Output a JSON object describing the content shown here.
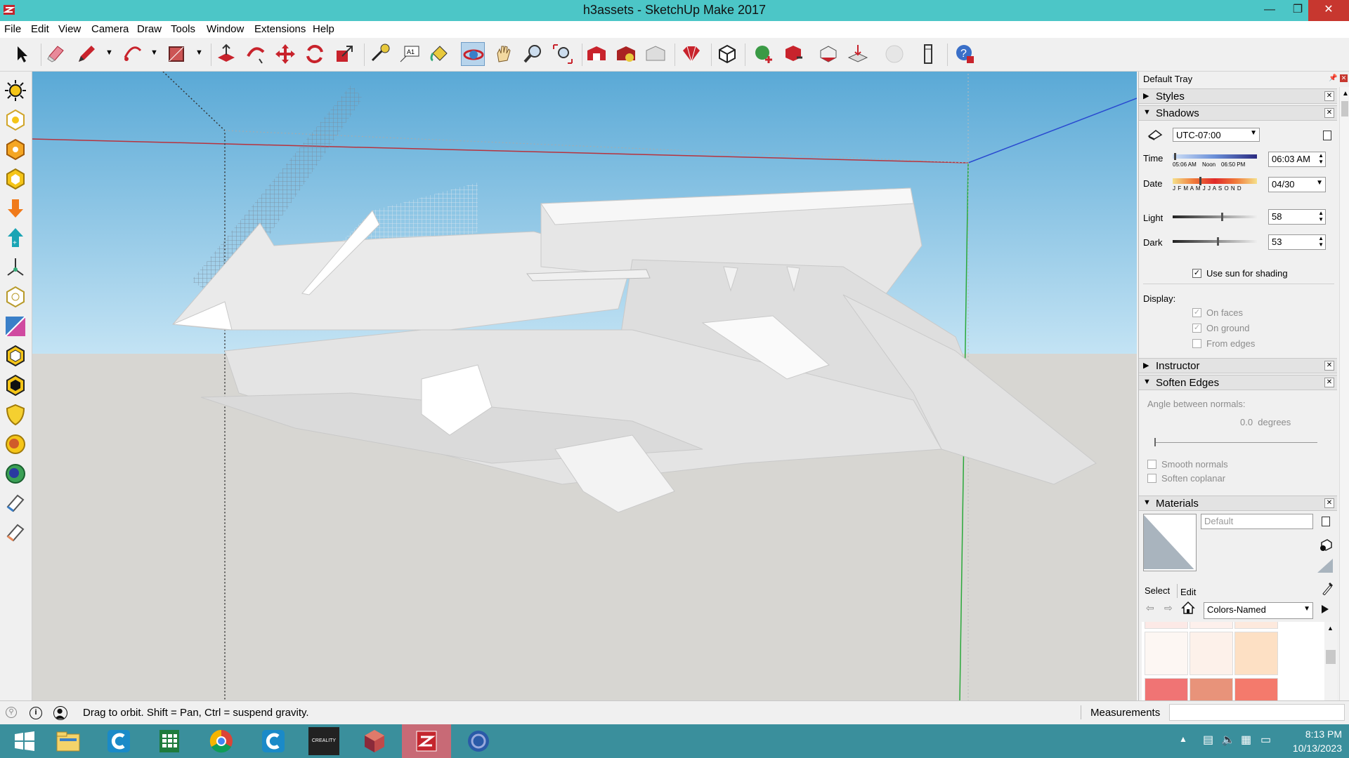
{
  "window": {
    "title": "h3assets - SketchUp Make 2017",
    "controls": [
      "minimize-icon",
      "restore-icon",
      "close-icon"
    ]
  },
  "menu": [
    "File",
    "Edit",
    "View",
    "Camera",
    "Draw",
    "Tools",
    "Window",
    "Extensions",
    "Help"
  ],
  "toolbar": {
    "tools": [
      "select-icon",
      "eraser-icon",
      "pencil-icon",
      "arc-icon",
      "rectangle-icon",
      "push-pull-icon",
      "follow-me-icon",
      "move-icon",
      "rotate-icon",
      "scale-icon",
      "tape-measure-icon",
      "text-icon",
      "paint-bucket-icon",
      "orbit-icon",
      "pan-icon",
      "zoom-icon",
      "zoom-extents-icon",
      "warehouse-icon",
      "extension-warehouse-icon",
      "layout-icon",
      "ruby-icon",
      "component-icon",
      "sandbox-icon",
      "sandbox-stamp-icon",
      "smoove-icon",
      "drape-icon",
      "sphere-icon",
      "solid-tools-icon",
      "help-icon"
    ],
    "active_tool": "orbit-icon"
  },
  "left_tools": [
    "sun-icon",
    "location-icon",
    "geo-icon",
    "shape-icon",
    "down-arrow-icon",
    "up-arrow-icon",
    "axes-icon",
    "section-icon",
    "section-fill-icon",
    "hexagon-icon",
    "black-hexagon-icon",
    "shield-icon",
    "orange-blob-icon",
    "globe-icon",
    "eraser-white-icon",
    "eraser-soft-icon"
  ],
  "tray": {
    "title": "Default Tray",
    "panels": {
      "styles": "Styles",
      "shadows": "Shadows",
      "instructor": "Instructor",
      "soften_edges": "Soften Edges",
      "materials": "Materials"
    },
    "shadows": {
      "timezone": "UTC-07:00",
      "time_label": "Time",
      "time_value": "06:03 AM",
      "time_scale": [
        "05:06 AM",
        "Noon",
        "06:50 PM"
      ],
      "date_label": "Date",
      "date_value": "04/30",
      "date_scale": "J F M A M J J A S O N D",
      "light_label": "Light",
      "light_value": "58",
      "dark_label": "Dark",
      "dark_value": "53",
      "use_sun_label": "Use sun for shading",
      "use_sun_checked": true,
      "display_label": "Display:",
      "display_options": [
        {
          "label": "On faces",
          "checked": true
        },
        {
          "label": "On ground",
          "checked": true
        },
        {
          "label": "From edges",
          "checked": false
        }
      ]
    },
    "soften_edges": {
      "angle_label": "Angle between normals:",
      "angle_value": "0.0  degrees",
      "smooth_normals": "Smooth normals",
      "soften_coplanar": "Soften coplanar"
    },
    "materials": {
      "name": "Default",
      "tabs": [
        "Select",
        "Edit"
      ],
      "library": "Colors-Named",
      "swatch_colors": [
        "#fce9e6",
        "#fdf0ec",
        "#fde9dd",
        "#fdf7f3",
        "#fdf1ea",
        "#fde0c4",
        "#f07474",
        "#e8937a",
        "#f47a6c"
      ]
    }
  },
  "status": {
    "message": "Drag to orbit. Shift = Pan, Ctrl = suspend gravity.",
    "measurements_label": "Measurements",
    "measurements_value": ""
  },
  "taskbar": {
    "apps": [
      "start-icon",
      "file-explorer-icon",
      "ccleaner-icon",
      "spreadsheet-icon",
      "chrome-icon",
      "ccleaner-alt-icon",
      "creality-icon",
      "3d-viewer-icon",
      "sketchup-icon",
      "browser-icon"
    ],
    "creality_label": "CREALITY",
    "time": "8:13 PM",
    "date": "10/13/2023"
  }
}
